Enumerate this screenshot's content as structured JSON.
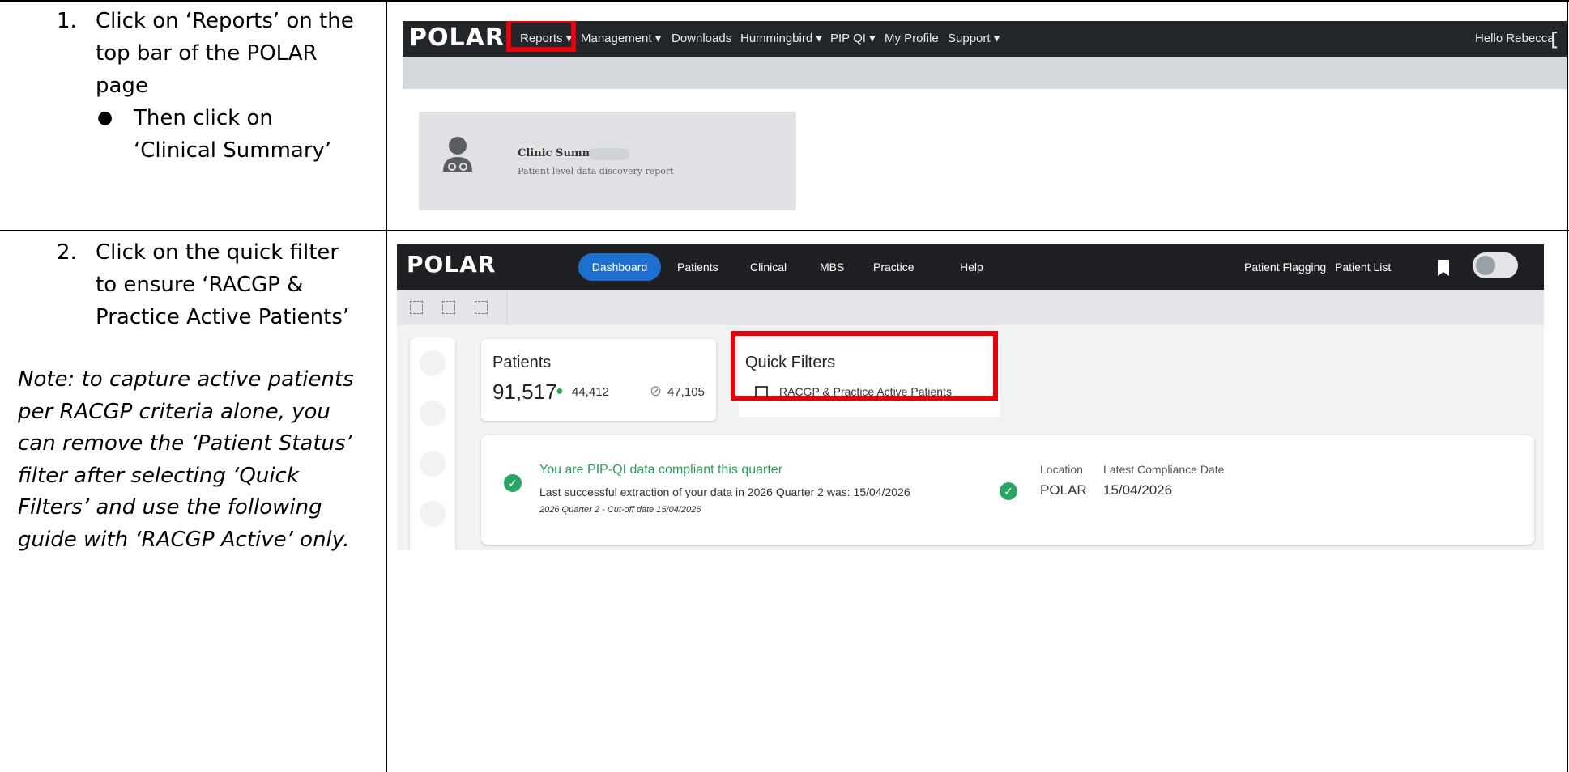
{
  "steps": [
    {
      "number": "1.",
      "lines": [
        "Click on ‘Reports’ on the",
        "top bar of the POLAR",
        "page"
      ],
      "bullet": [
        "Then click on",
        "‘Clinical Summary’"
      ]
    },
    {
      "number": "2.",
      "lines": [
        "Click on the quick filter",
        "to ensure ‘RACGP &",
        "Practice Active Patients’"
      ]
    }
  ],
  "note": [
    "Note: to capture active patients",
    "per RACGP criteria alone, you",
    "can remove the ‘Patient Status’",
    "filter after selecting ‘Quick",
    "Filters’ and use the following",
    "guide with ‘RACGP Active’ only."
  ],
  "screenshot1": {
    "logo": "POLAR",
    "nav": [
      "Reports ▾",
      "Management ▾",
      "Downloads",
      "Hummingbird ▾",
      "PIP QI ▾",
      "My Profile",
      "Support ▾"
    ],
    "greeting": "Hello Rebecca",
    "card_title": "Clinic Summary",
    "card_subtitle": "Patient level data discovery report"
  },
  "screenshot2": {
    "logo": "POLAR",
    "nav": [
      "Dashboard",
      "Patients",
      "Clinical",
      "MBS",
      "Practice",
      "Help"
    ],
    "nav_right": [
      "Patient Flagging",
      "Patient List"
    ],
    "patients_title": "Patients",
    "patients_total": "91,517",
    "patients_male": "44,412",
    "patients_female": "47,105",
    "quick_filters_title": "Quick Filters",
    "quick_filter_label": "RACGP & Practice Active Patients",
    "compliance_message": "You are PIP-QI data compliant this quarter",
    "compliance_line": "Last successful extraction of your data in 2026 Quarter 2 was: 15/04/2026",
    "compliance_cutoff": "2026 Quarter 2 - Cut-off date 15/04/2026",
    "location_label": "Location",
    "location_value": "POLAR",
    "latest_label": "Latest Compliance Date",
    "latest_value": "15/04/2026"
  },
  "colors": {
    "highlight": "#e8000b",
    "topbar": "#23262a",
    "accent": "#1e6fd0",
    "success": "#27a561"
  }
}
